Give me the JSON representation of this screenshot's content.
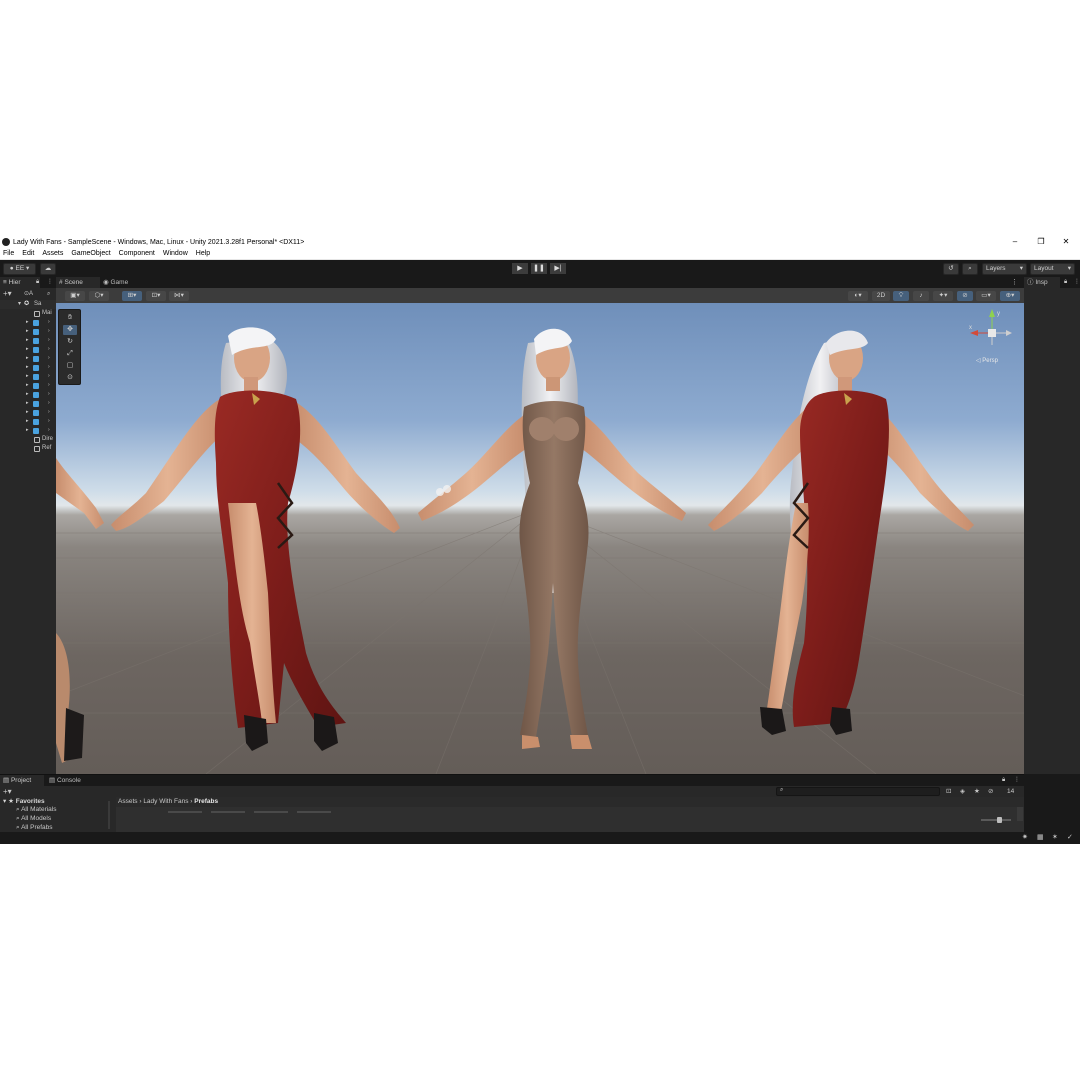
{
  "window": {
    "title": "Lady With Fans - SampleScene - Windows, Mac, Linux - Unity 2021.3.28f1 Personal* <DX11>",
    "minimize": "–",
    "maximize": "❐",
    "close": "✕"
  },
  "menu": [
    "File",
    "Edit",
    "Assets",
    "GameObject",
    "Component",
    "Window",
    "Help"
  ],
  "toolbar": {
    "account": "EE",
    "layers": "Layers",
    "layout": "Layout"
  },
  "hierarchy": {
    "tab": "Hier",
    "scene": "Sa",
    "items": [
      "Mai",
      "Dire",
      "Ref"
    ]
  },
  "scene_tabs": {
    "scene": "Scene",
    "game": "Game"
  },
  "scene_toolbar": {
    "mode_2d": "2D"
  },
  "gizmo": {
    "persp": "◁ Persp",
    "x_axis": "x",
    "y_axis": "y"
  },
  "inspector": {
    "tab": "Insp"
  },
  "project": {
    "tab_project": "Project",
    "tab_console": "Console",
    "favorites": "Favorites",
    "fav_items": [
      "All Materials",
      "All Models",
      "All Prefabs"
    ],
    "breadcrumb": [
      "Assets",
      "Lady With Fans",
      "Prefabs"
    ],
    "count": "14"
  },
  "colors": {
    "dress": "#7d1d1a",
    "skin": "#d9a484",
    "body_suit": "#8b7060",
    "hair": "#e6e6e8",
    "accent": "#46607c"
  }
}
